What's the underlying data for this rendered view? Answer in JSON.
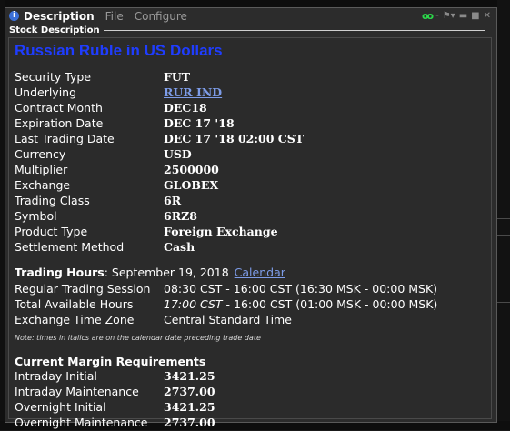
{
  "window": {
    "title": "Description",
    "menu": [
      "File",
      "Configure"
    ],
    "section_header": "Stock Description"
  },
  "instrument": {
    "heading": "Russian Ruble in US Dollars",
    "fields": [
      {
        "label": "Security Type",
        "value": "FUT"
      },
      {
        "label": "Underlying",
        "value": "RUR IND",
        "link": true
      },
      {
        "label": "Contract Month",
        "value": "DEC18"
      },
      {
        "label": "Expiration Date",
        "value": "DEC 17 '18"
      },
      {
        "label": "Last Trading Date",
        "value": "DEC 17 '18 02:00 CST"
      },
      {
        "label": "Currency",
        "value": "USD"
      },
      {
        "label": "Multiplier",
        "value": "2500000"
      },
      {
        "label": "Exchange",
        "value": "GLOBEX"
      },
      {
        "label": "Trading Class",
        "value": "6R"
      },
      {
        "label": "Symbol",
        "value": "6RZ8"
      },
      {
        "label": "Product Type",
        "value": "Foreign Exchange"
      },
      {
        "label": "Settlement Method",
        "value": "Cash"
      }
    ]
  },
  "trading_hours": {
    "label": "Trading Hours",
    "date": ": September 19, 2018",
    "calendar_link": "Calendar",
    "rows": [
      {
        "label": "Regular Trading Session",
        "value_italic": "",
        "value": "08:30 CST - 16:00 CST (16:30 MSK - 00:00 MSK)"
      },
      {
        "label": "Total Available Hours",
        "value_italic": "17:00 CST",
        "value": " - 16:00 CST (01:00 MSK - 00:00 MSK)"
      },
      {
        "label": "Exchange Time Zone",
        "value_italic": "",
        "value": "Central Standard Time"
      }
    ],
    "note": "Note: times in italics are on the calendar date preceding trade date"
  },
  "margin": {
    "heading": "Current Margin Requirements",
    "rows": [
      {
        "label": "Intraday Initial",
        "value": "3421.25"
      },
      {
        "label": "Intraday Maintenance",
        "value": "2737.00"
      },
      {
        "label": "Overnight Initial",
        "value": "3421.25"
      },
      {
        "label": "Overnight Maintenance",
        "value": "2737.00"
      }
    ]
  },
  "colors": {
    "heading": "#1f3dff",
    "link": "#7d9ce8",
    "link_icon": "#2bd84a",
    "info_icon": "#3b6fd8"
  }
}
